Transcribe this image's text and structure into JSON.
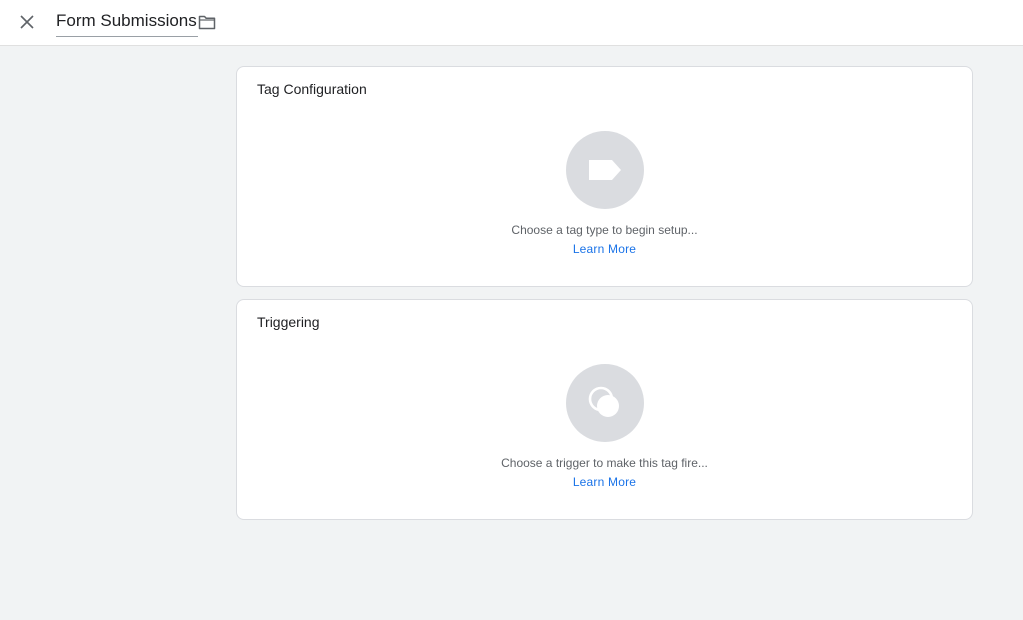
{
  "header": {
    "title": "Form Submissions",
    "close_icon": "close-icon",
    "folder_icon": "folder-icon"
  },
  "tag_configuration": {
    "title": "Tag Configuration",
    "icon": "tag-icon",
    "hint": "Choose a tag type to begin setup...",
    "link": "Learn More"
  },
  "triggering": {
    "title": "Triggering",
    "icon": "trigger-icon",
    "hint": "Choose a trigger to make this tag fire...",
    "link": "Learn More"
  },
  "colors": {
    "accent": "#1a73e8",
    "background": "#f1f3f4",
    "placeholder_circle": "#dadce0"
  }
}
